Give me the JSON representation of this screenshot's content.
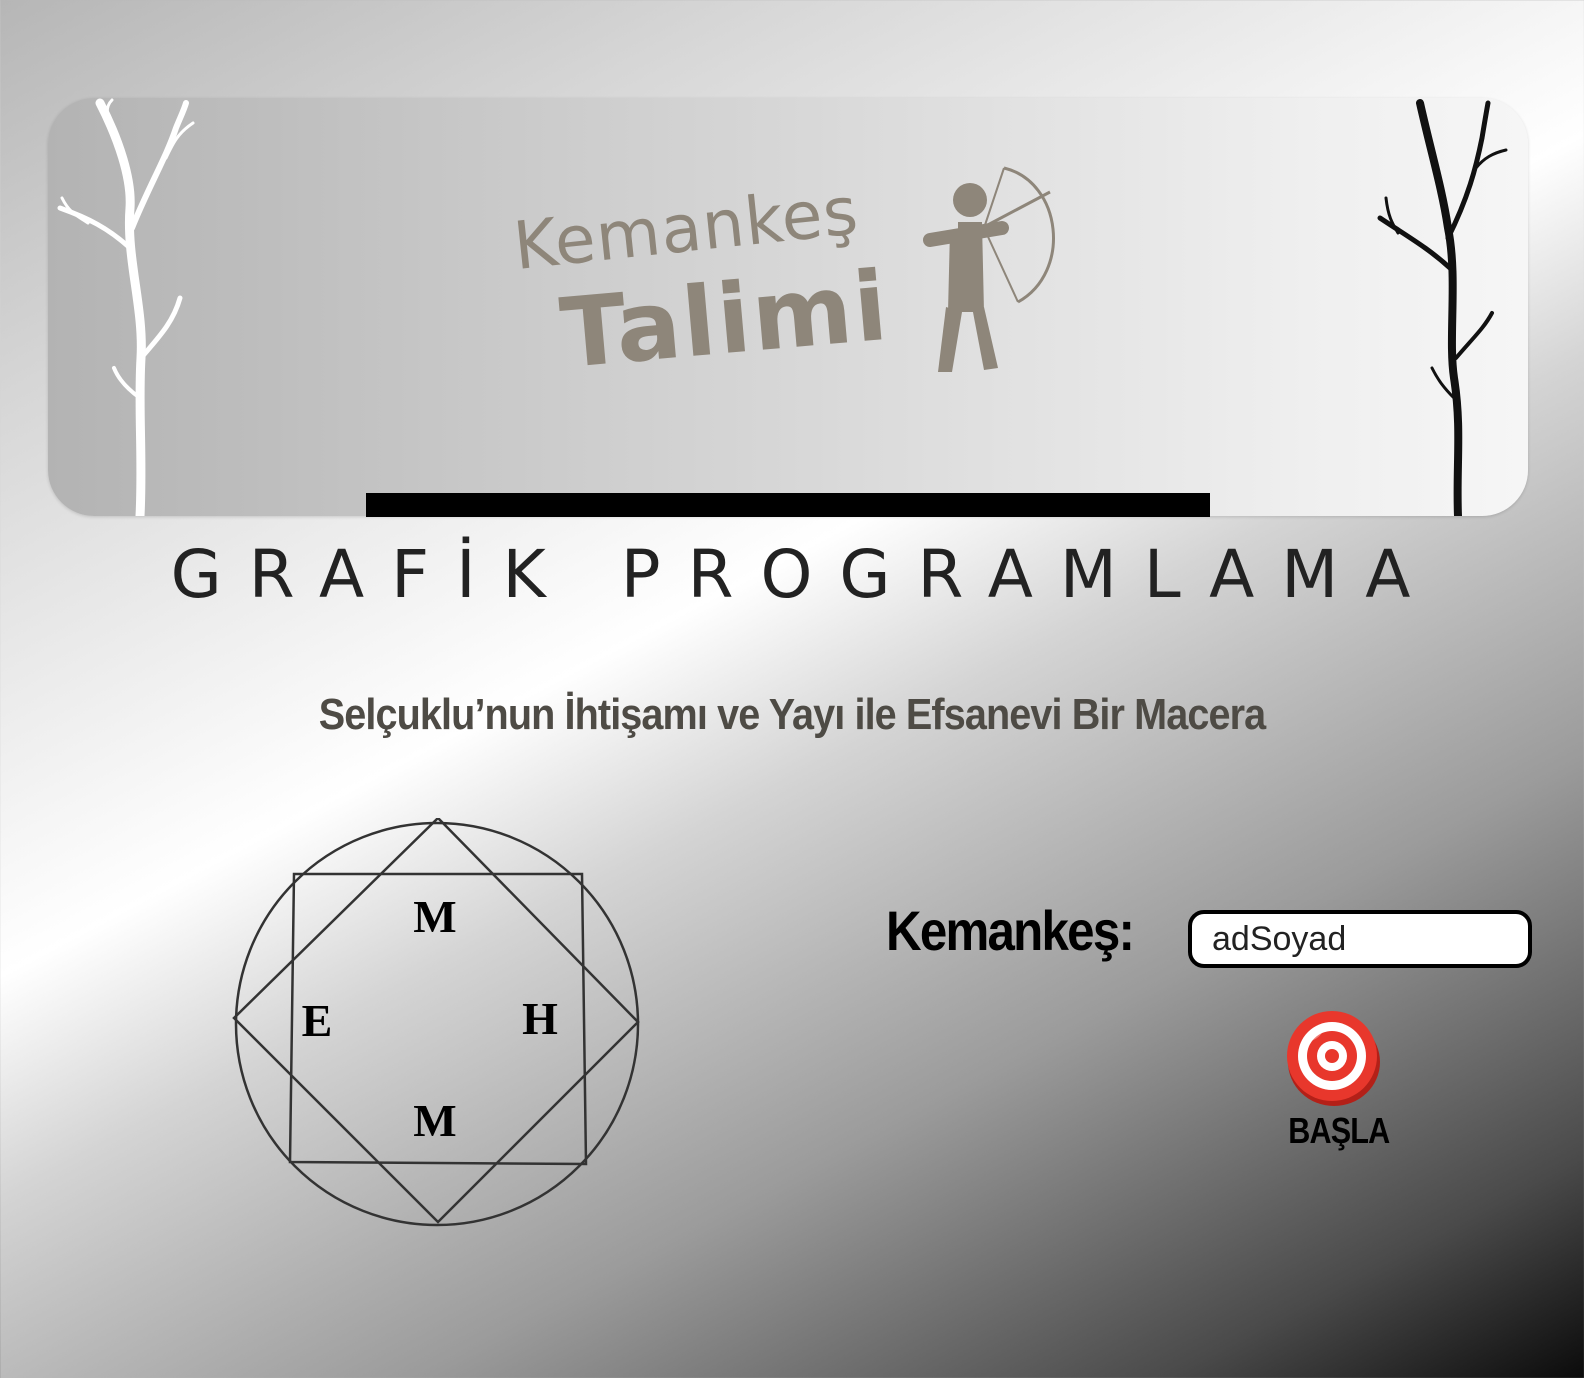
{
  "banner": {
    "logo_line1": "Kemankeş",
    "logo_line2": "Talimi"
  },
  "subtitle": "GRAFİK PROGRAMLAMA",
  "tagline": "Selçuklu’nun İhtişamı ve Yayı ile Efsanevi Bir Macera",
  "emblem": {
    "top": "M",
    "left": "E",
    "right": "H",
    "bottom": "M"
  },
  "player": {
    "label": "Kemankeş:",
    "input_value": "adSoyad"
  },
  "start": {
    "label": "BAŞLA",
    "icon": "target-icon"
  },
  "colors": {
    "logo": "#8e867a",
    "tagline": "#4e4b45",
    "target_red": "#e8372c"
  }
}
